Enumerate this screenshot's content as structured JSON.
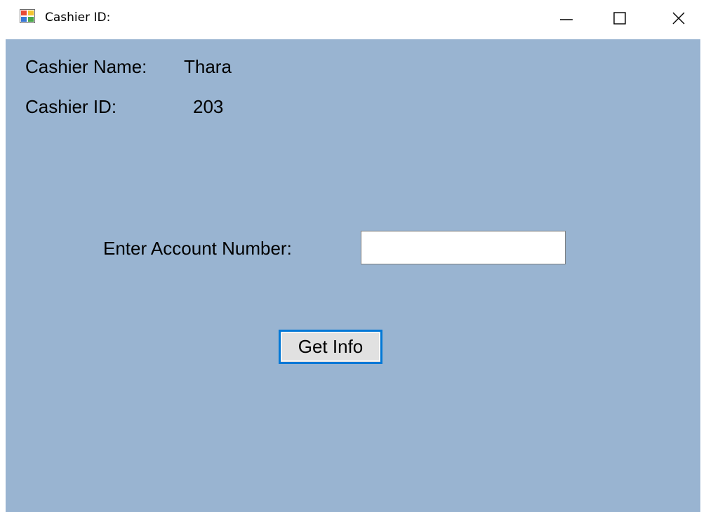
{
  "window": {
    "title": "Cashier ID:",
    "icon": "winforms-app-icon",
    "controls": {
      "minimize_icon": "minimize-icon",
      "maximize_icon": "maximize-icon",
      "close_icon": "close-icon"
    }
  },
  "colors": {
    "client_background": "#99b4d1",
    "button_focus_border": "#0078d7"
  },
  "cashier": {
    "name_label": "Cashier Name:",
    "name_value": "Thara",
    "id_label": "Cashier ID:",
    "id_value": "203"
  },
  "account": {
    "label": "Enter Account Number:",
    "value": ""
  },
  "get_info_button": {
    "label": "Get Info"
  }
}
